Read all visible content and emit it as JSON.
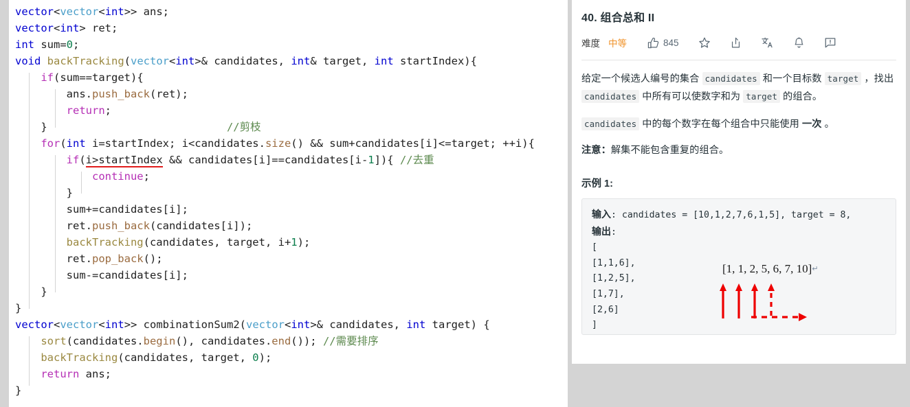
{
  "editor": {
    "language": "cpp",
    "lines": [
      [
        {
          "t": "vector",
          "c": "kw"
        },
        {
          "t": "<",
          "c": "pl"
        },
        {
          "t": "vector",
          "c": "typ"
        },
        {
          "t": "<",
          "c": "pl"
        },
        {
          "t": "int",
          "c": "kw"
        },
        {
          "t": ">> ans;",
          "c": "pl"
        }
      ],
      [
        {
          "t": "vector",
          "c": "kw"
        },
        {
          "t": "<",
          "c": "pl"
        },
        {
          "t": "int",
          "c": "kw"
        },
        {
          "t": "> ret;",
          "c": "pl"
        }
      ],
      [
        {
          "t": "int",
          "c": "kw"
        },
        {
          "t": " sum=",
          "c": "pl"
        },
        {
          "t": "0",
          "c": "num"
        },
        {
          "t": ";",
          "c": "pl"
        }
      ],
      [
        {
          "t": "void",
          "c": "kw"
        },
        {
          "t": " ",
          "c": "pl"
        },
        {
          "t": "backTracking",
          "c": "fn"
        },
        {
          "t": "(",
          "c": "pl"
        },
        {
          "t": "vector",
          "c": "typ"
        },
        {
          "t": "<",
          "c": "pl"
        },
        {
          "t": "int",
          "c": "kw"
        },
        {
          "t": ">& candidates, ",
          "c": "pl"
        },
        {
          "t": "int",
          "c": "kw"
        },
        {
          "t": "& target, ",
          "c": "pl"
        },
        {
          "t": "int",
          "c": "kw"
        },
        {
          "t": " startIndex){",
          "c": "pl"
        }
      ],
      [
        {
          "t": "    ",
          "c": "pl"
        },
        {
          "t": "if",
          "c": "ctl"
        },
        {
          "t": "(sum==target){",
          "c": "pl"
        }
      ],
      [
        {
          "t": "        ans.",
          "c": "pl"
        },
        {
          "t": "push_back",
          "c": "mem"
        },
        {
          "t": "(ret);",
          "c": "pl"
        }
      ],
      [
        {
          "t": "        ",
          "c": "pl"
        },
        {
          "t": "return",
          "c": "ctl"
        },
        {
          "t": ";",
          "c": "pl"
        }
      ],
      [
        {
          "t": "    }                            ",
          "c": "pl"
        },
        {
          "t": "//剪枝",
          "c": "cmt"
        }
      ],
      [
        {
          "t": "    ",
          "c": "pl"
        },
        {
          "t": "for",
          "c": "ctl"
        },
        {
          "t": "(",
          "c": "pl"
        },
        {
          "t": "int",
          "c": "kw"
        },
        {
          "t": " i=startIndex; i<candidates.",
          "c": "pl"
        },
        {
          "t": "size",
          "c": "mem"
        },
        {
          "t": "() && sum+candidates[i]<=target; ++i){",
          "c": "pl"
        }
      ],
      [
        {
          "t": "        ",
          "c": "pl"
        },
        {
          "t": "if",
          "c": "ctl"
        },
        {
          "t": "(",
          "c": "pl"
        },
        {
          "t": "i>startIndex",
          "c": "err"
        },
        {
          "t": " && candidates[i]==candidates[i-",
          "c": "pl"
        },
        {
          "t": "1",
          "c": "num"
        },
        {
          "t": "]){ ",
          "c": "pl"
        },
        {
          "t": "//去重",
          "c": "cmt"
        }
      ],
      [
        {
          "t": "            ",
          "c": "pl"
        },
        {
          "t": "continue",
          "c": "ctl"
        },
        {
          "t": ";",
          "c": "pl"
        }
      ],
      [
        {
          "t": "        }",
          "c": "pl"
        }
      ],
      [
        {
          "t": "        sum+=candidates[i];",
          "c": "pl"
        }
      ],
      [
        {
          "t": "        ret.",
          "c": "pl"
        },
        {
          "t": "push_back",
          "c": "mem"
        },
        {
          "t": "(candidates[i]);",
          "c": "pl"
        }
      ],
      [
        {
          "t": "        ",
          "c": "pl"
        },
        {
          "t": "backTracking",
          "c": "fn"
        },
        {
          "t": "(candidates, target, i+",
          "c": "pl"
        },
        {
          "t": "1",
          "c": "num"
        },
        {
          "t": ");",
          "c": "pl"
        }
      ],
      [
        {
          "t": "        ret.",
          "c": "pl"
        },
        {
          "t": "pop_back",
          "c": "mem"
        },
        {
          "t": "();",
          "c": "pl"
        }
      ],
      [
        {
          "t": "        sum-=candidates[i];",
          "c": "pl"
        }
      ],
      [
        {
          "t": "    }",
          "c": "pl"
        }
      ],
      [
        {
          "t": "}",
          "c": "pl"
        }
      ],
      [
        {
          "t": "vector",
          "c": "kw"
        },
        {
          "t": "<",
          "c": "pl"
        },
        {
          "t": "vector",
          "c": "typ"
        },
        {
          "t": "<",
          "c": "pl"
        },
        {
          "t": "int",
          "c": "kw"
        },
        {
          "t": ">> combinationSum2(",
          "c": "pl"
        },
        {
          "t": "vector",
          "c": "typ"
        },
        {
          "t": "<",
          "c": "pl"
        },
        {
          "t": "int",
          "c": "kw"
        },
        {
          "t": ">& candidates, ",
          "c": "pl"
        },
        {
          "t": "int",
          "c": "kw"
        },
        {
          "t": " target) {",
          "c": "pl"
        }
      ],
      [
        {
          "t": "    ",
          "c": "pl"
        },
        {
          "t": "sort",
          "c": "fn"
        },
        {
          "t": "(candidates.",
          "c": "pl"
        },
        {
          "t": "begin",
          "c": "mem"
        },
        {
          "t": "(), candidates.",
          "c": "pl"
        },
        {
          "t": "end",
          "c": "mem"
        },
        {
          "t": "()); ",
          "c": "pl"
        },
        {
          "t": "//需要排序",
          "c": "cmt"
        }
      ],
      [
        {
          "t": "    ",
          "c": "pl"
        },
        {
          "t": "backTracking",
          "c": "fn"
        },
        {
          "t": "(candidates, target, ",
          "c": "pl"
        },
        {
          "t": "0",
          "c": "num"
        },
        {
          "t": ");",
          "c": "pl"
        }
      ],
      [
        {
          "t": "    ",
          "c": "pl"
        },
        {
          "t": "return",
          "c": "ctl"
        },
        {
          "t": " ans;",
          "c": "pl"
        }
      ],
      [
        {
          "t": "}",
          "c": "pl"
        }
      ]
    ]
  },
  "problem": {
    "title": "40. 组合总和 II",
    "difficulty_label": "难度",
    "difficulty_value": "中等",
    "difficulty_color": "#f0932b",
    "like_count": "845",
    "icons": [
      "thumbs-up-icon",
      "star-icon",
      "share-icon",
      "translate-icon",
      "bell-icon",
      "comment-icon"
    ],
    "desc_p1_a": "给定一个候选人编号的集合 ",
    "desc_p1_code1": "candidates",
    "desc_p1_b": " 和一个目标数 ",
    "desc_p1_code2": "target",
    "desc_p1_c": " ，找出 ",
    "desc_p1_code3": "candidates",
    "desc_p1_d": " 中所有可以使数字和为 ",
    "desc_p1_code4": "target",
    "desc_p1_e": " 的组合。",
    "desc_p2_code": "candidates",
    "desc_p2_a": " 中的每个数字在每个组合中只能使用 ",
    "desc_p2_bold": "一次",
    "desc_p2_b": " 。",
    "note_title": "注意：",
    "note_body": "解集不能包含重复的组合。",
    "example_title": "示例 1:",
    "example_text": "输入: candidates = [10,1,2,7,6,1,5], target = 8,\n输出:\n[\n[1,1,6],\n[1,2,5],\n[1,7],\n[2,6]\n]",
    "example_input_label": "输入",
    "example_output_label": "输出",
    "annotation_text": "[1, 1, 2, 5, 6, 7, 10]",
    "annotation_cr": "↵",
    "annotation_color": "#ee0000",
    "annotation_arrows": {
      "solid_up": 3,
      "dashed_up": 1,
      "dashed_right": 1
    }
  }
}
